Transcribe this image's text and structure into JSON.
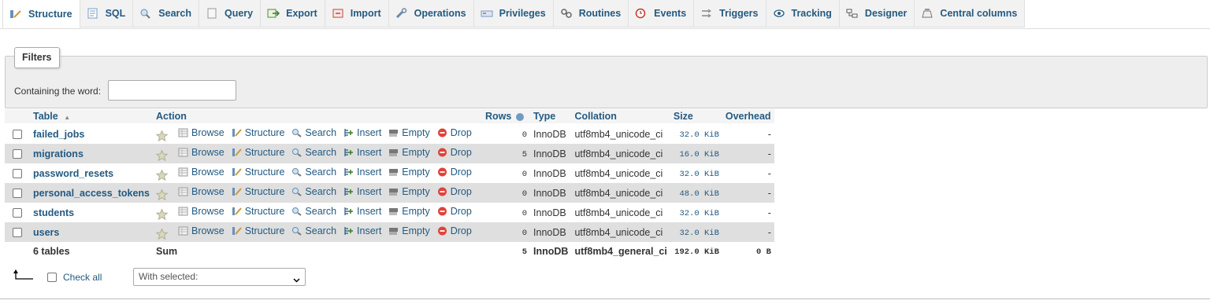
{
  "tabs": [
    {
      "label": "Structure",
      "icon": "structure-icon",
      "active": true
    },
    {
      "label": "SQL",
      "icon": "sql-icon"
    },
    {
      "label": "Search",
      "icon": "search-icon"
    },
    {
      "label": "Query",
      "icon": "query-icon"
    },
    {
      "label": "Export",
      "icon": "export-icon"
    },
    {
      "label": "Import",
      "icon": "import-icon"
    },
    {
      "label": "Operations",
      "icon": "wrench-icon"
    },
    {
      "label": "Privileges",
      "icon": "privileges-icon"
    },
    {
      "label": "Routines",
      "icon": "routines-icon"
    },
    {
      "label": "Events",
      "icon": "clock-icon"
    },
    {
      "label": "Triggers",
      "icon": "triggers-icon"
    },
    {
      "label": "Tracking",
      "icon": "eye-icon"
    },
    {
      "label": "Designer",
      "icon": "designer-icon"
    },
    {
      "label": "Central columns",
      "icon": "columns-icon"
    }
  ],
  "filters": {
    "legend": "Filters",
    "label": "Containing the word:",
    "value": ""
  },
  "table": {
    "headers": {
      "table": "Table",
      "sort_arrow": "▲",
      "action": "Action",
      "rows": "Rows",
      "type": "Type",
      "collation": "Collation",
      "size": "Size",
      "overhead": "Overhead"
    },
    "actions": [
      "Browse",
      "Structure",
      "Search",
      "Insert",
      "Empty",
      "Drop"
    ],
    "rows": [
      {
        "name": "failed_jobs",
        "rows": "0",
        "type": "InnoDB",
        "collation": "utf8mb4_unicode_ci",
        "size": "32.0",
        "unit": "KiB",
        "overhead": "-"
      },
      {
        "name": "migrations",
        "rows": "5",
        "type": "InnoDB",
        "collation": "utf8mb4_unicode_ci",
        "size": "16.0",
        "unit": "KiB",
        "overhead": "-"
      },
      {
        "name": "password_resets",
        "rows": "0",
        "type": "InnoDB",
        "collation": "utf8mb4_unicode_ci",
        "size": "32.0",
        "unit": "KiB",
        "overhead": "-"
      },
      {
        "name": "personal_access_tokens",
        "rows": "0",
        "type": "InnoDB",
        "collation": "utf8mb4_unicode_ci",
        "size": "48.0",
        "unit": "KiB",
        "overhead": "-"
      },
      {
        "name": "students",
        "rows": "0",
        "type": "InnoDB",
        "collation": "utf8mb4_unicode_ci",
        "size": "32.0",
        "unit": "KiB",
        "overhead": "-"
      },
      {
        "name": "users",
        "rows": "0",
        "type": "InnoDB",
        "collation": "utf8mb4_unicode_ci",
        "size": "32.0",
        "unit": "KiB",
        "overhead": "-"
      }
    ],
    "summary": {
      "count": "6 tables",
      "sum": "Sum",
      "rows": "5",
      "type": "InnoDB",
      "collation": "utf8mb4_general_ci",
      "size": "192.0",
      "unit": "KiB",
      "overhead": "0",
      "overhead_unit": "B"
    }
  },
  "bottom": {
    "check_all": "Check all",
    "with_selected": "With selected:"
  },
  "colors": {
    "link": "#235a81",
    "row_even": "#dfdfdf",
    "drop_icon": "#e0433b"
  }
}
